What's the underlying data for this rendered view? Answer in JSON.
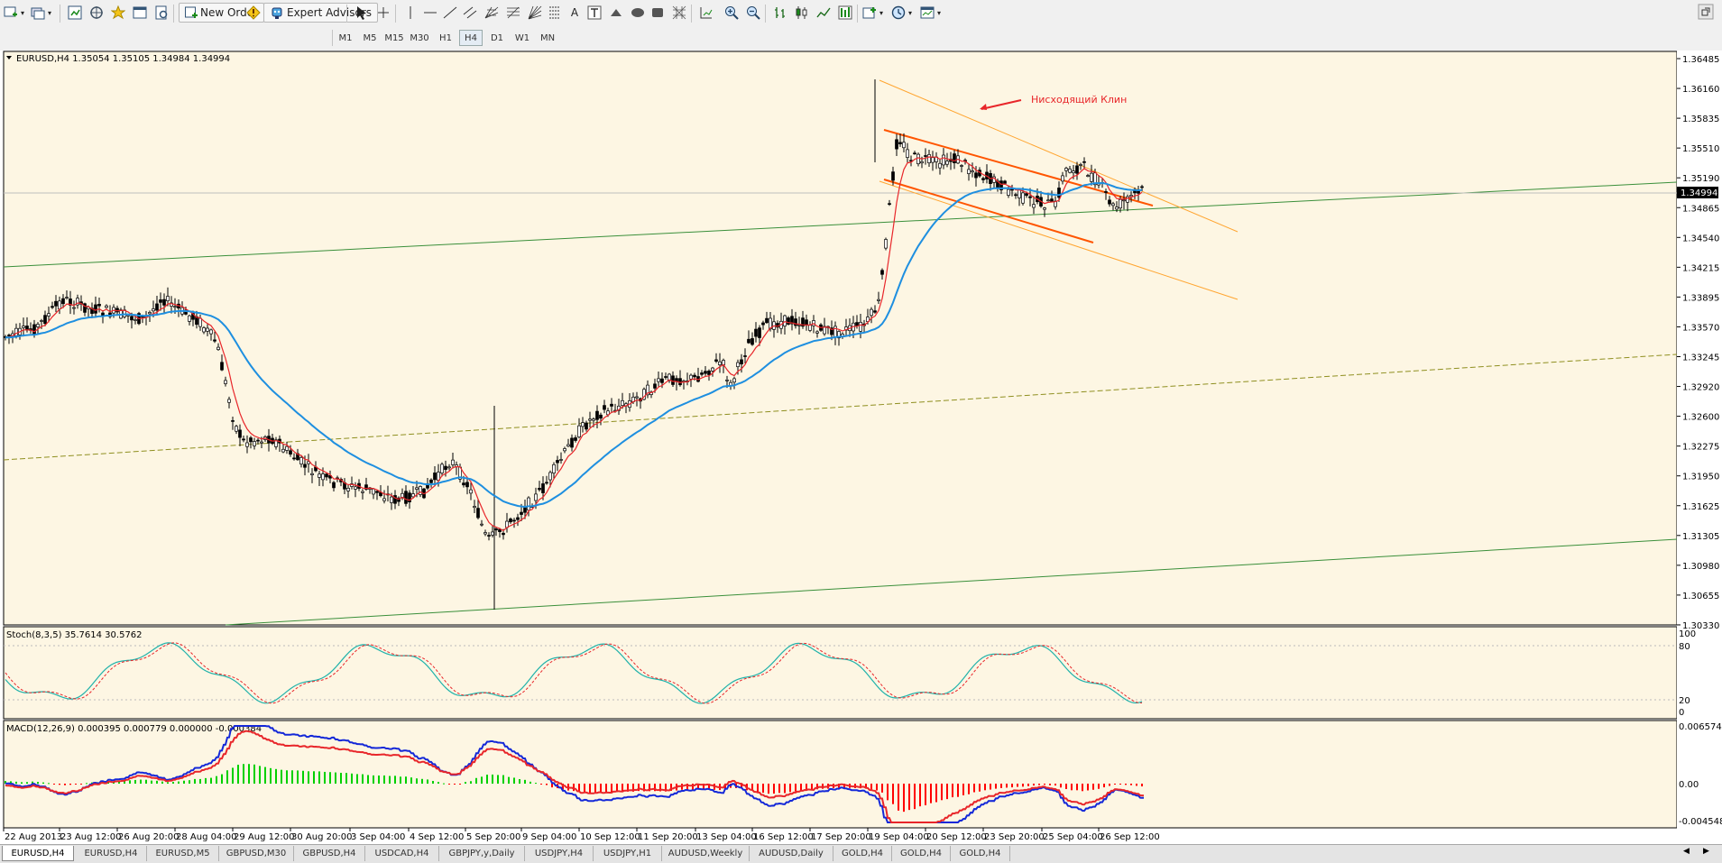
{
  "toolbar": {
    "new_order_label": "New Order",
    "expert_advisors_label": "Expert Advisors",
    "text_tool_label": "A",
    "timeframes": [
      "M1",
      "M5",
      "M15",
      "M30",
      "H1",
      "H4",
      "D1",
      "W1",
      "MN"
    ],
    "active_timeframe": "H4"
  },
  "chart": {
    "header": "EURUSD,H4  1.35054 1.35105 1.34984 1.34994",
    "annotation": "Нисходящий Клин",
    "current_price": "1.34994",
    "price_ticks": [
      "1.36485",
      "1.36160",
      "1.35835",
      "1.35510",
      "1.35190",
      "1.34865",
      "1.34540",
      "1.34215",
      "1.33895",
      "1.33570",
      "1.33245",
      "1.32920",
      "1.32600",
      "1.32275",
      "1.31950",
      "1.31625",
      "1.31305",
      "1.30980",
      "1.30655",
      "1.30330"
    ],
    "time_ticks": [
      "22 Aug 2013",
      "23 Aug 12:00",
      "26 Aug 20:00",
      "28 Aug 04:00",
      "29 Aug 12:00",
      "30 Aug 20:00",
      "3 Sep 04:00",
      "4 Sep 12:00",
      "5 Sep 20:00",
      "9 Sep 04:00",
      "10 Sep 12:00",
      "11 Sep 20:00",
      "13 Sep 04:00",
      "16 Sep 12:00",
      "17 Sep 20:00",
      "19 Sep 04:00",
      "20 Sep 12:00",
      "23 Sep 20:00",
      "25 Sep 04:00",
      "26 Sep 12:00"
    ],
    "colors": {
      "background": "#fdf6e3",
      "ma_fast": "#e8262a",
      "ma_slow": "#1e8fe0",
      "wedge": "#ff5500",
      "channel": "#ffa530",
      "trend": "#3a8f3a",
      "dashed": "#8f8f20"
    }
  },
  "stoch": {
    "header": "Stoch(8,3,5) 35.7614 30.5762",
    "ticks": [
      "100",
      "80",
      "20",
      "0"
    ]
  },
  "macd": {
    "header": "MACD(12,26,9) 0.000395 0.000779 0.000000 -0.000384",
    "ticks": [
      "0.006574",
      "0.00",
      "-0.004548"
    ]
  },
  "tabs": [
    "EURUSD,H4",
    "EURUSD,H4",
    "EURUSD,M5",
    "GBPUSD,M30",
    "GBPUSD,H4",
    "USDCAD,H4",
    "GBPJPY,y,Daily",
    "USDJPY,H4",
    "USDJPY,H1",
    "AUDUSD,Weekly",
    "AUDUSD,Daily",
    "GOLD,H4",
    "GOLD,H4",
    "GOLD,H4"
  ],
  "active_tab": 0
}
